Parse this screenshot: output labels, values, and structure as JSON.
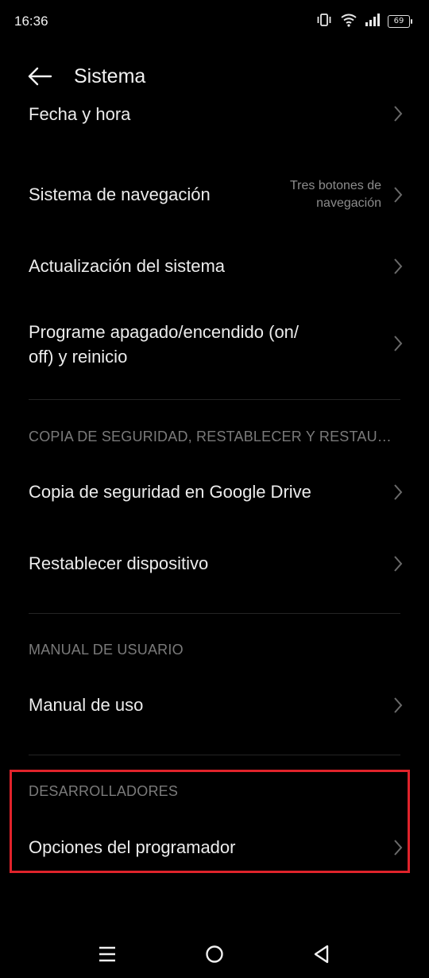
{
  "status_bar": {
    "time": "16:36",
    "battery_level": "69",
    "icons": [
      "vibrate-icon",
      "wifi-icon",
      "signal-icon",
      "battery-icon"
    ]
  },
  "header": {
    "title": "Sistema",
    "back_icon": "arrow-left-icon"
  },
  "items": {
    "fecha_hora": {
      "label": "Fecha y hora"
    },
    "navegacion": {
      "label": "Sistema de navegación",
      "value_line1": "Tres botones de",
      "value_line2": "navegación"
    },
    "actualizacion": {
      "label": "Actualización del sistema"
    },
    "programe_line1": "Programe apagado/encendido (on/",
    "programe_line2": "off) y reinicio",
    "copia_google": {
      "label": "Copia de seguridad en Google Drive"
    },
    "restablecer": {
      "label": "Restablecer dispositivo"
    },
    "manual_uso": {
      "label": "Manual de uso"
    },
    "opciones_programador": {
      "label": "Opciones del programador"
    }
  },
  "sections": {
    "copia": "COPIA DE SEGURIDAD, RESTABLECER Y RESTAU…",
    "manual": "MANUAL DE USUARIO",
    "desarrolladores": "DESARROLLADORES"
  },
  "nav_bar": {
    "icons": [
      "menu-icon",
      "home-icon",
      "back-triangle-icon"
    ]
  },
  "colors": {
    "background": "#000000",
    "text_primary": "#ececec",
    "text_secondary": "#8c8c8c",
    "section_header": "#7a7a7a",
    "highlight": "#e0232b"
  }
}
